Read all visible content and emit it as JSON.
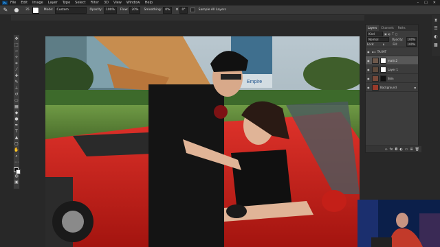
{
  "menu": {
    "items": [
      "File",
      "Edit",
      "Image",
      "Layer",
      "Type",
      "Select",
      "Filter",
      "3D",
      "View",
      "Window",
      "Help"
    ],
    "logo": "Ps"
  },
  "options": {
    "size_value": "35",
    "mode_label": "Mode:",
    "mode_value": "Custom",
    "opacity_label": "Opacity:",
    "opacity_value": "100%",
    "flow_label": "Flow:",
    "flow_value": "20%",
    "smoothing_label": "Smoothing:",
    "smoothing_value": "0%",
    "sample_label": "Sample All Layers",
    "angle_value": "0°"
  },
  "layers_panel": {
    "tabs": [
      "Layers",
      "Channels",
      "Paths"
    ],
    "kind_label": "Kind",
    "blend_mode": "Normal",
    "opacity_label": "Opacity:",
    "opacity_value": "100%",
    "lock_label": "Lock:",
    "fill_label": "Fill:",
    "fill_value": "100%",
    "layers": [
      {
        "name": "TAI MT",
        "selected": false,
        "has_mask": false
      },
      {
        "name": "mat/c2",
        "selected": true,
        "has_mask": true
      },
      {
        "name": "Layer 1",
        "selected": false,
        "has_mask": true
      },
      {
        "name": "Skin",
        "selected": false,
        "has_mask": true
      },
      {
        "name": "Background",
        "selected": false,
        "has_mask": false
      }
    ]
  },
  "colors": {
    "ui_dark": "#282828",
    "panel": "#3c3c3c",
    "selected_layer": "#585858",
    "accent": "#31a8ff"
  }
}
